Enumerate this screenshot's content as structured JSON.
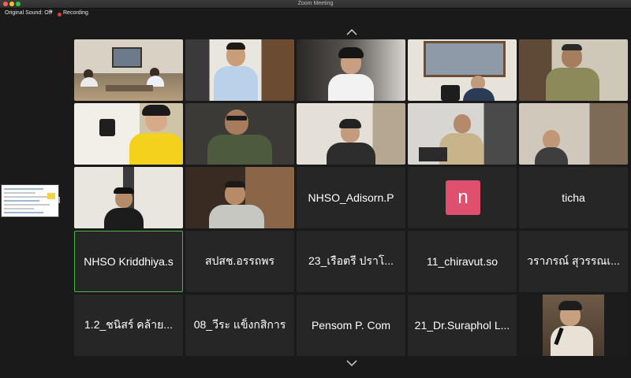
{
  "window": {
    "title": "Zoom Meeting"
  },
  "toolbar": {
    "original_sound": "Original Sound: Off",
    "recording": "Recording"
  },
  "colors": {
    "active_speaker": "#4bb54b",
    "avatar_n": "#df4f6e",
    "recording": "#e33a3a"
  },
  "gallery": {
    "name_tiles": [
      "NHSO_Adisorn.P",
      "ticha",
      "NHSO Kriddhiya.s",
      "สปสช.อรรถพร",
      "23_เรือตรี ปราโ...",
      "11_chiravut.so",
      "วราภรณ์ สุวรรณเ...",
      "1.2_ชนิสร์ คล้าย...",
      "08_วีระ แข็งกสิการ",
      "Pensom P. Com",
      "21_Dr.Suraphol L..."
    ],
    "avatar_initial": "n"
  }
}
